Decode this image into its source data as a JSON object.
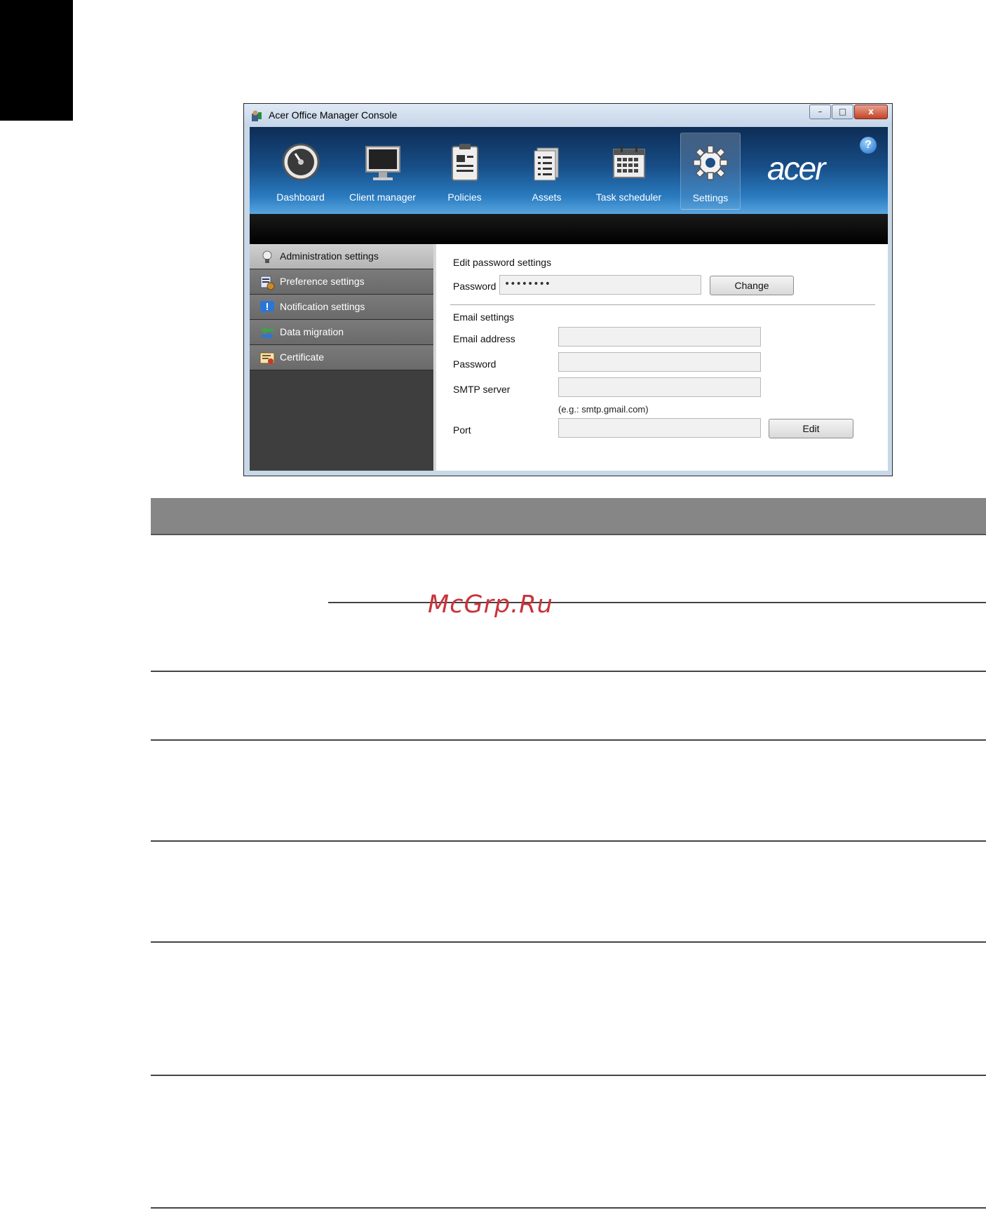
{
  "window": {
    "title": "Acer Office Manager Console",
    "controls": {
      "minimize": "–",
      "maximize": "□",
      "close": "x"
    }
  },
  "header": {
    "nav": [
      {
        "label": "Dashboard",
        "icon": "dashboard-icon"
      },
      {
        "label": "Client manager",
        "icon": "monitor-icon"
      },
      {
        "label": "Policies",
        "icon": "clipboard-icon"
      },
      {
        "label": "Assets",
        "icon": "document-list-icon"
      },
      {
        "label": "Task scheduler",
        "icon": "calendar-icon"
      },
      {
        "label": "Settings",
        "icon": "gear-icon",
        "active": true
      }
    ],
    "logo": "acer",
    "help": "?"
  },
  "sidebar": {
    "items": [
      {
        "label": "Administration settings",
        "icon": "lightbulb-icon",
        "active": true
      },
      {
        "label": "Preference settings",
        "icon": "preferences-icon"
      },
      {
        "label": "Notification settings",
        "icon": "notification-icon"
      },
      {
        "label": "Data migration",
        "icon": "migration-arrows-icon"
      },
      {
        "label": "Certificate",
        "icon": "certificate-icon"
      }
    ]
  },
  "content": {
    "password_section": {
      "title": "Edit password settings",
      "password_label": "Password",
      "password_value": "••••••••",
      "change_button": "Change"
    },
    "email_section": {
      "title": "Email settings",
      "email_label": "Email address",
      "email_value": "",
      "password_label": "Password",
      "password_value": "",
      "smtp_label": "SMTP server",
      "smtp_value": "",
      "smtp_hint": "(e.g.: smtp.gmail.com)",
      "port_label": "Port",
      "port_value": "",
      "edit_button": "Edit"
    }
  },
  "watermark": "McGrp.Ru",
  "colors": {
    "header_top": "#0d2d55",
    "header_bottom": "#58a5df",
    "sidebar_bg": "#3e3e3e",
    "watermark": "#c9333a",
    "band": "#868686"
  }
}
